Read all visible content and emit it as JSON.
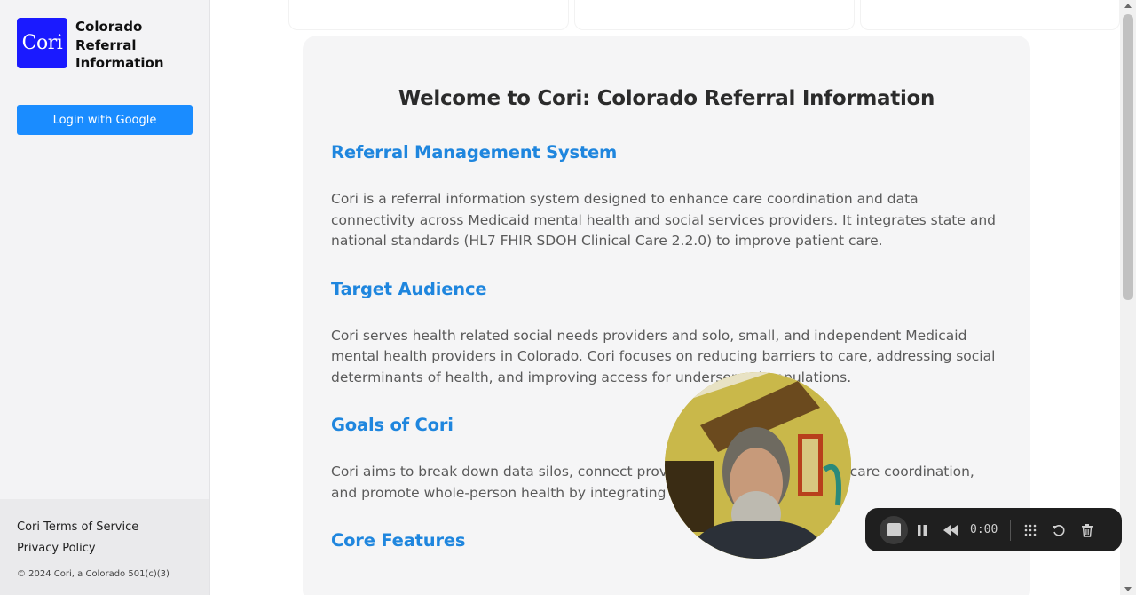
{
  "sidebar": {
    "logo": {
      "mark": "Cori",
      "title": "Colorado Referral Information"
    },
    "login_button": "Login with Google",
    "footer": {
      "terms_link": "Cori Terms of Service",
      "privacy_link": "Privacy Policy",
      "copyright": "© 2024 Cori, a Colorado 501(c)(3)"
    }
  },
  "main": {
    "title": "Welcome to Cori: Colorado Referral Information",
    "sections": [
      {
        "heading": "Referral Management System",
        "body": "Cori is a referral information system designed to enhance care coordination and data connectivity across Medicaid mental health and social services providers. It integrates state and national standards (HL7 FHIR SDOH Clinical Care 2.2.0) to improve patient care."
      },
      {
        "heading": "Target Audience",
        "body": "Cori serves health related social needs providers and solo, small, and independent Medicaid mental health providers in Colorado. Cori focuses on reducing barriers to care, addressing social determinants of health, and improving access for underserved populations."
      },
      {
        "heading": "Goals of Cori",
        "body": "Cori aims to break down data silos, connect providers and improve patient care coordination, and promote whole-person health by integrating clinical, and social care"
      },
      {
        "heading": "Core Features",
        "body": ""
      }
    ],
    "accent_color": "#1f86de"
  },
  "recorder": {
    "timer": "0:00",
    "icons": [
      "stop-icon",
      "pause-icon",
      "rewind-icon",
      "grid-icon",
      "restart-icon",
      "trash-icon"
    ]
  }
}
